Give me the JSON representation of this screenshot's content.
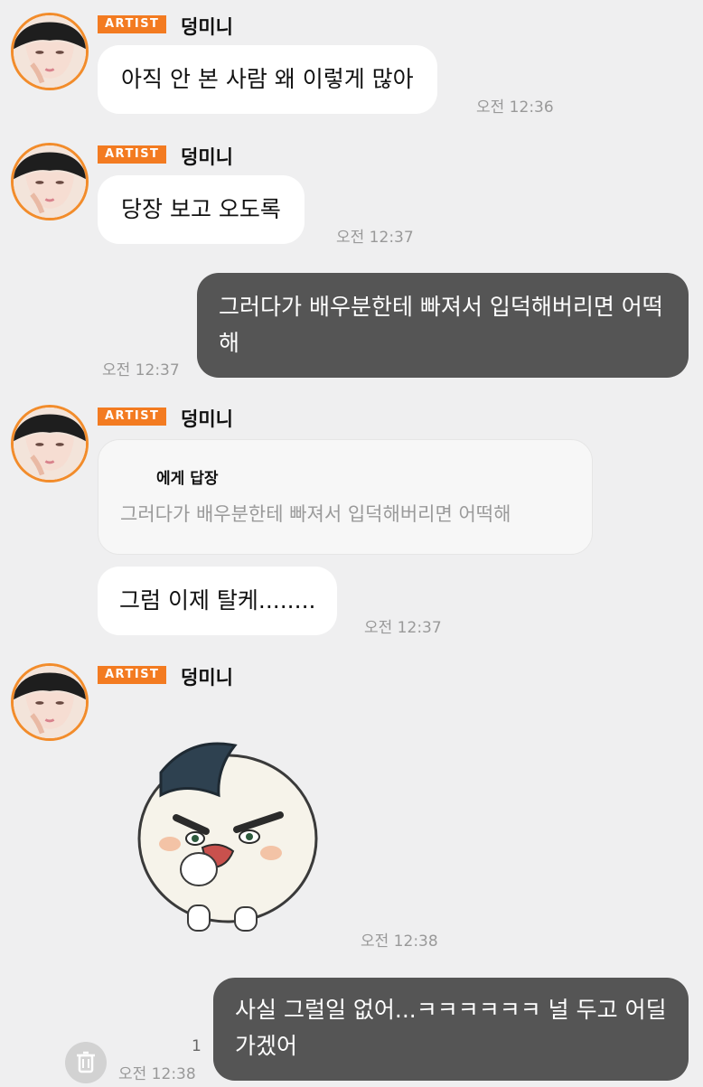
{
  "messages": [
    {
      "badge": "ARTIST",
      "sender": "덩미니",
      "text": "아직 안 본 사람 왜 이렇게 많아",
      "time": "오전 12:36"
    },
    {
      "badge": "ARTIST",
      "sender": "덩미니",
      "text": "당장 보고 오도록",
      "time": "오전 12:37"
    },
    {
      "text": "그러다가 배우분한테 빠져서 입덕해버리면 어떡해",
      "time": "오전 12:37"
    },
    {
      "badge": "ARTIST",
      "sender": "덩미니",
      "reply": {
        "title": "에게 답장",
        "text": "그러다가 배우분한테 빠져서 입덕해버리면 어떡해"
      },
      "text": "그럼 이제 탈케........",
      "time": "오전 12:37"
    },
    {
      "badge": "ARTIST",
      "sender": "덩미니",
      "sticker": "rice-ball-character-eating-sticker",
      "time": "오전 12:38"
    },
    {
      "text": "사실 그럴일 없어...ㅋㅋㅋㅋㅋㅋ 널 두고 어딜가겠어",
      "time": "오전 12:38",
      "unread_count": "1"
    }
  ],
  "icons": {
    "avatar": "artist-avatar",
    "delete": "trash-icon"
  },
  "colors": {
    "accent": "#f37b21",
    "my_bubble": "#555555",
    "background": "#efeff0"
  }
}
